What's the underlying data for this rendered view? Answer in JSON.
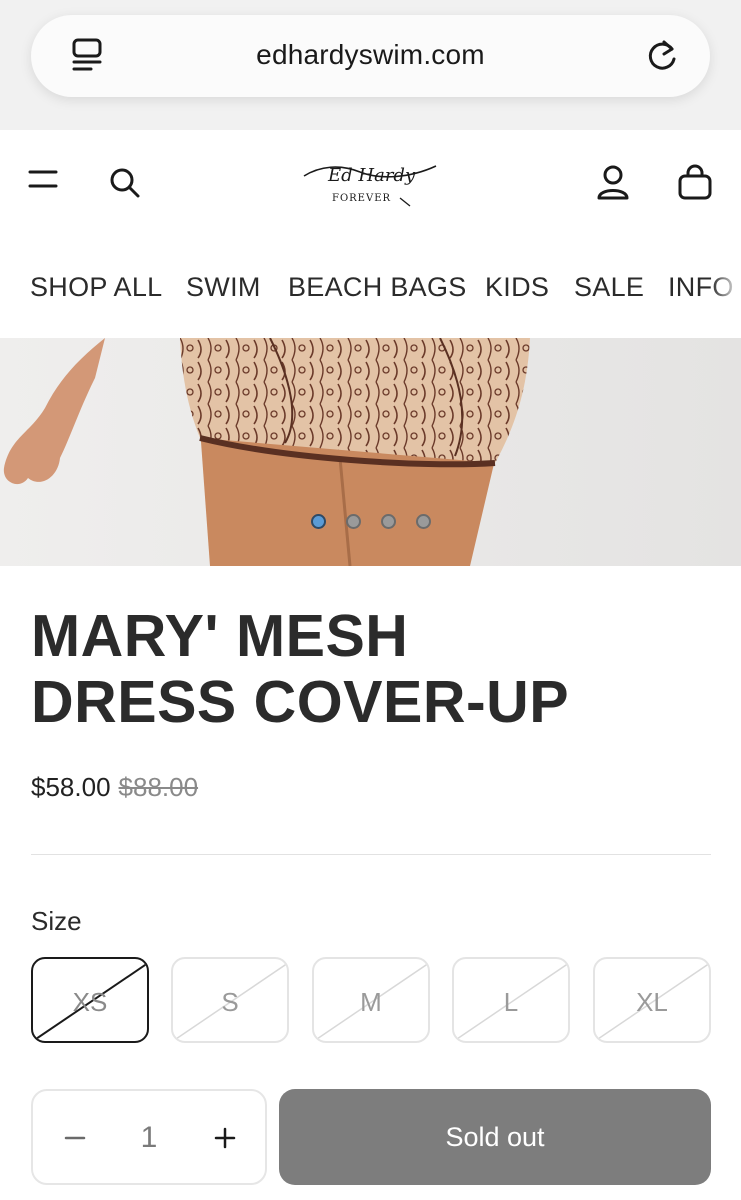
{
  "browser": {
    "url": "edhardyswim.com",
    "icons": [
      "reader-mode-icon",
      "reload-icon"
    ]
  },
  "header": {
    "logo_text": "Ed Hardy",
    "logo_subtext": "FOREVER",
    "icons": [
      "menu-icon",
      "search-icon",
      "account-icon",
      "cart-icon"
    ]
  },
  "nav": {
    "items": [
      {
        "label": "SHOP ALL"
      },
      {
        "label": "SWIM"
      },
      {
        "label": "BEACH BAGS"
      },
      {
        "label": "KIDS"
      },
      {
        "label": "SALE"
      },
      {
        "label": "INFO"
      }
    ]
  },
  "gallery": {
    "slide_count": 4,
    "active_slide": 1
  },
  "product": {
    "title_line1": "MARY' MESH",
    "title_line2": "DRESS COVER-UP",
    "price": "$58.00",
    "compare_price": "$88.00",
    "size_label": "Size",
    "sizes": [
      {
        "label": "XS",
        "selected": true,
        "available": false
      },
      {
        "label": "S",
        "selected": false,
        "available": false
      },
      {
        "label": "M",
        "selected": false,
        "available": false
      },
      {
        "label": "L",
        "selected": false,
        "available": false
      },
      {
        "label": "XL",
        "selected": false,
        "available": false
      }
    ],
    "quantity": "1",
    "button_label": "Sold out"
  },
  "colors": {
    "button_bg": "#7d7d7d",
    "active_dot": "#5b9bd5",
    "text": "#2b2b2b"
  }
}
